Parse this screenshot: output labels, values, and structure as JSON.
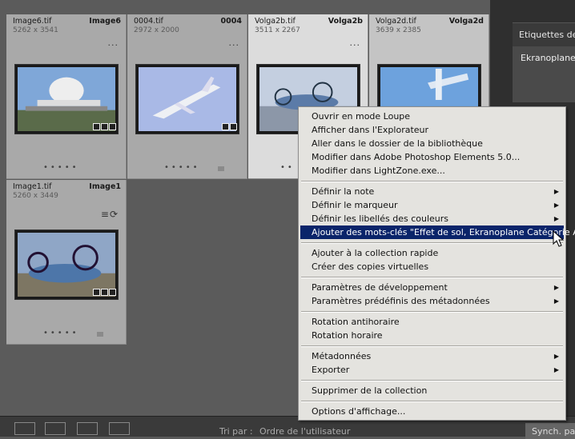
{
  "thumbnails": [
    {
      "name": "Image6.tif",
      "dims": "5262 x 3541",
      "index": "Image6",
      "more": "···"
    },
    {
      "name": "0004.tif",
      "dims": "2972 x 2000",
      "index": "0004",
      "more": "···"
    },
    {
      "name": "Volga2b.tif",
      "dims": "3511 x 2267",
      "index": "Volga2b",
      "more": "···"
    },
    {
      "name": "Volga2d.tif",
      "dims": "3639 x 2385",
      "index": "Volga2d",
      "more": ""
    },
    {
      "name": "Image1.tif",
      "dims": "5260 x 3449",
      "index": "Image1",
      "more": ""
    }
  ],
  "right_panel": {
    "header": "Etiquettes de",
    "keyword": "Ekranoplane,"
  },
  "bottom_bar": {
    "sort_label": "Tri par :",
    "sort_value": "Ordre de l'utilisateur",
    "sync": "Synch. pa"
  },
  "context_menu": {
    "items": [
      {
        "label": "Ouvrir en mode Loupe",
        "arrow": ""
      },
      {
        "label": "Afficher dans l'Explorateur",
        "arrow": ""
      },
      {
        "label": "Aller dans le dossier de la bibliothèque",
        "arrow": ""
      },
      {
        "label": "Modifier dans Adobe Photoshop Elements 5.0...",
        "arrow": ""
      },
      {
        "label": "Modifier dans LightZone.exe...",
        "arrow": ""
      },
      {
        "label": "Définir la note",
        "arrow": "▶"
      },
      {
        "label": "Définir le marqueur",
        "arrow": "▶"
      },
      {
        "label": "Définir les libellés des couleurs",
        "arrow": "▶"
      },
      {
        "label": "Ajouter des mots-clés \"Effet de sol, Ekranoplane Catégorie A\"",
        "arrow": ""
      },
      {
        "label": "Ajouter à la collection rapide",
        "arrow": ""
      },
      {
        "label": "Créer des copies virtuelles",
        "arrow": ""
      },
      {
        "label": "Paramètres de développement",
        "arrow": "▶"
      },
      {
        "label": "Paramètres prédéfinis des métadonnées",
        "arrow": "▶"
      },
      {
        "label": "Rotation antihoraire",
        "arrow": ""
      },
      {
        "label": "Rotation horaire",
        "arrow": ""
      },
      {
        "label": "Métadonnées",
        "arrow": "▶"
      },
      {
        "label": "Exporter",
        "arrow": "▶"
      },
      {
        "label": "Supprimer de la collection",
        "arrow": ""
      },
      {
        "label": "Options d'affichage...",
        "arrow": ""
      }
    ]
  }
}
